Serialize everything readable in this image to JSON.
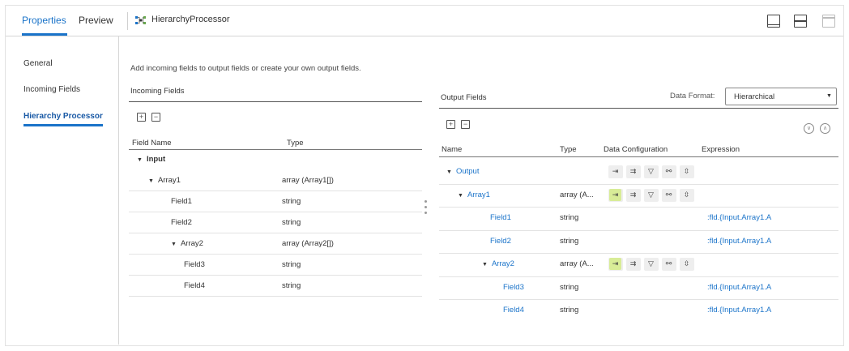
{
  "tabs": [
    {
      "label": "Properties",
      "active": true
    },
    {
      "label": "Preview",
      "active": false
    }
  ],
  "processor_title": "HierarchyProcessor",
  "nav": [
    {
      "label": "General",
      "active": false
    },
    {
      "label": "Incoming Fields",
      "active": false
    },
    {
      "label": "Hierarchy Processor",
      "active": true
    }
  ],
  "description": "Add incoming fields to output fields or create your own output fields.",
  "incoming": {
    "title": "Incoming Fields",
    "col_name": "Field Name",
    "col_type": "Type",
    "rows": [
      {
        "name": "Input",
        "type": "",
        "level": 0,
        "expand": true,
        "bold": true
      },
      {
        "name": "Array1",
        "type": "array (Array1[])",
        "level": 1,
        "expand": true,
        "bold": false
      },
      {
        "name": "Field1",
        "type": "string",
        "level": 2,
        "expand": false,
        "bold": false
      },
      {
        "name": "Field2",
        "type": "string",
        "level": 2,
        "expand": false,
        "bold": false
      },
      {
        "name": "Array2",
        "type": "array (Array2[])",
        "level": 2,
        "expand": true,
        "bold": false
      },
      {
        "name": "Field3",
        "type": "string",
        "level": 3,
        "expand": false,
        "bold": false
      },
      {
        "name": "Field4",
        "type": "string",
        "level": 3,
        "expand": false,
        "bold": false
      }
    ]
  },
  "output": {
    "title": "Output Fields",
    "format_label": "Data Format:",
    "format_value": "Hierarchical",
    "col_name": "Name",
    "col_type": "Type",
    "col_config": "Data Configuration",
    "col_expr": "Expression",
    "rows": [
      {
        "name": "Output",
        "type": "",
        "level": 0,
        "expand": true,
        "expr": "",
        "config": true,
        "highlight": false
      },
      {
        "name": "Array1",
        "type": "array (A...",
        "level": 1,
        "expand": true,
        "expr": "",
        "config": true,
        "highlight": true
      },
      {
        "name": "Field1",
        "type": "string",
        "level": 2,
        "expand": false,
        "expr": ":fld.{Input.Array1.A",
        "config": false,
        "highlight": false
      },
      {
        "name": "Field2",
        "type": "string",
        "level": 2,
        "expand": false,
        "expr": ":fld.{Input.Array1.A",
        "config": false,
        "highlight": false
      },
      {
        "name": "Array2",
        "type": "array (A...",
        "level": 2,
        "expand": true,
        "expr": "",
        "config": true,
        "highlight": true
      },
      {
        "name": "Field3",
        "type": "string",
        "level": 3,
        "expand": false,
        "expr": ":fld.{Input.Array1.A",
        "config": false,
        "highlight": false
      },
      {
        "name": "Field4",
        "type": "string",
        "level": 3,
        "expand": false,
        "expr": ":fld.{Input.Array1.A",
        "config": false,
        "highlight": false
      }
    ]
  },
  "colors": {
    "accent": "#1a73c9",
    "highlight": "#d8ec97"
  }
}
